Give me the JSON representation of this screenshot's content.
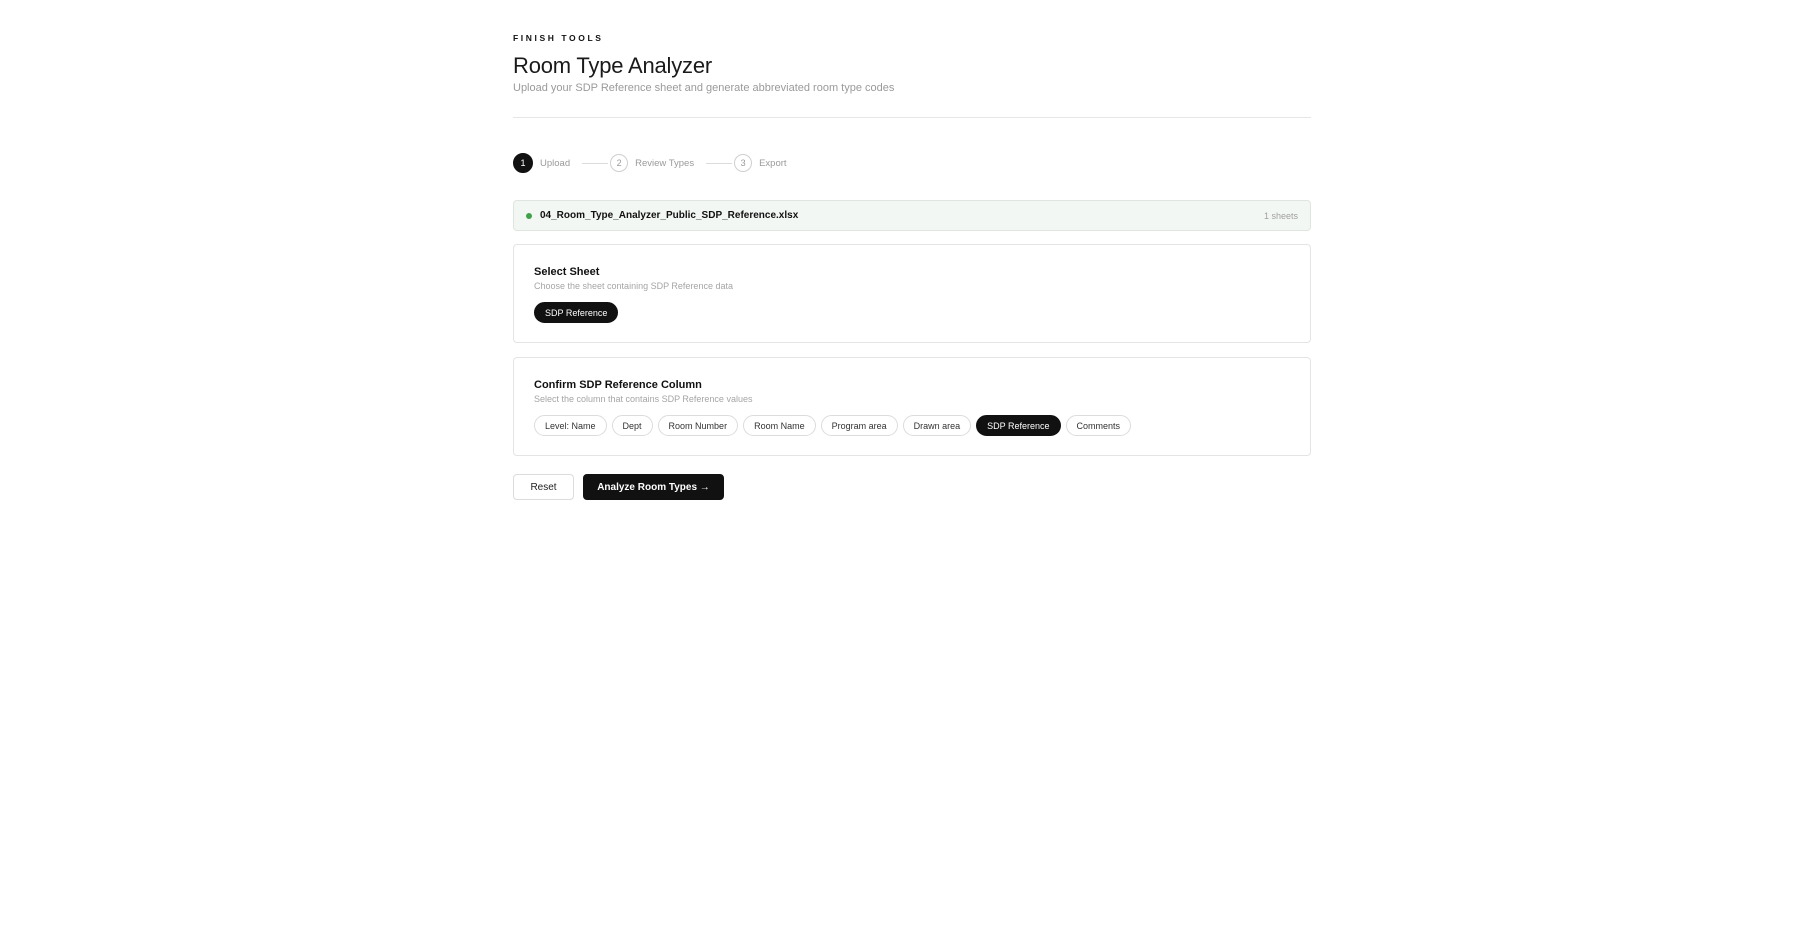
{
  "header": {
    "eyebrow": "FINISH TOOLS",
    "title": "Room Type Analyzer",
    "subtitle": "Upload your SDP Reference sheet and generate abbreviated room type codes"
  },
  "stepper": {
    "steps": [
      {
        "number": "1",
        "label": "Upload",
        "active": true
      },
      {
        "number": "2",
        "label": "Review Types",
        "active": false
      },
      {
        "number": "3",
        "label": "Export",
        "active": false
      }
    ]
  },
  "file": {
    "name": "04_Room_Type_Analyzer_Public_SDP_Reference.xlsx",
    "sheet_count": "1 sheets",
    "status_color": "#3fa24a"
  },
  "sheet_select": {
    "title": "Select Sheet",
    "description": "Choose the sheet containing SDP Reference data",
    "options": [
      "SDP Reference"
    ],
    "selected": "SDP Reference"
  },
  "column_select": {
    "title": "Confirm SDP Reference Column",
    "description": "Select the column that contains SDP Reference values",
    "options": [
      "Level: Name",
      "Dept",
      "Room Number",
      "Room Name",
      "Program area",
      "Drawn area",
      "SDP Reference",
      "Comments"
    ],
    "selected": "SDP Reference"
  },
  "actions": {
    "reset_label": "Reset",
    "analyze_label": "Analyze Room Types →"
  },
  "colors": {
    "accent": "#111111",
    "success": "#3fa24a"
  }
}
